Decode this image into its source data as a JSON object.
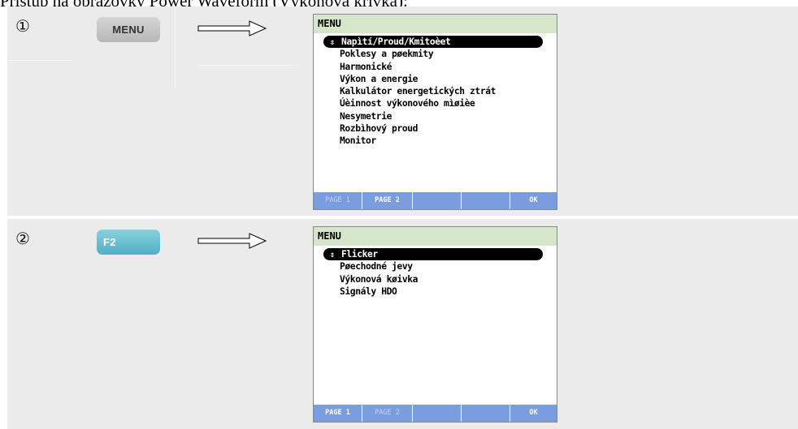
{
  "caption": "Přístup na obrazovky Power Waveform (Výkonová křivka):",
  "steps": [
    {
      "number": "①",
      "key_label": "MENU",
      "screen": {
        "header": "MENU",
        "items": [
          "Napìtí/Proud/Kmitoèet",
          "Poklesy a pøekmity",
          "Harmonické",
          "Výkon a energie",
          "Kalkulátor energetických ztrát",
          "Úèinnost výkonového mìøièe",
          "Nesymetrie",
          "Rozbìhový proud",
          "Monitor"
        ],
        "selected_index": 0,
        "softkeys": [
          "PAGE 1",
          "PAGE 2",
          "",
          "",
          "OK"
        ],
        "active_page": "PAGE 2"
      }
    },
    {
      "number": "②",
      "key_label": "F2",
      "screen": {
        "header": "MENU",
        "items": [
          "Flicker",
          "Pøechodné jevy",
          "Výkonová køivka",
          "Signály HDO"
        ],
        "selected_index": 0,
        "softkeys": [
          "PAGE 1",
          "PAGE 2",
          "",
          "",
          "OK"
        ],
        "active_page": "PAGE 1"
      }
    }
  ],
  "selection_arrow": "⇕",
  "colors": {
    "row_bg": "#ebebeb",
    "screen_header": "#d5e6cb",
    "softkey_bar": "#7a9de0",
    "menu_key": "#c4c4c4",
    "f2_key": "#5fbacd"
  }
}
